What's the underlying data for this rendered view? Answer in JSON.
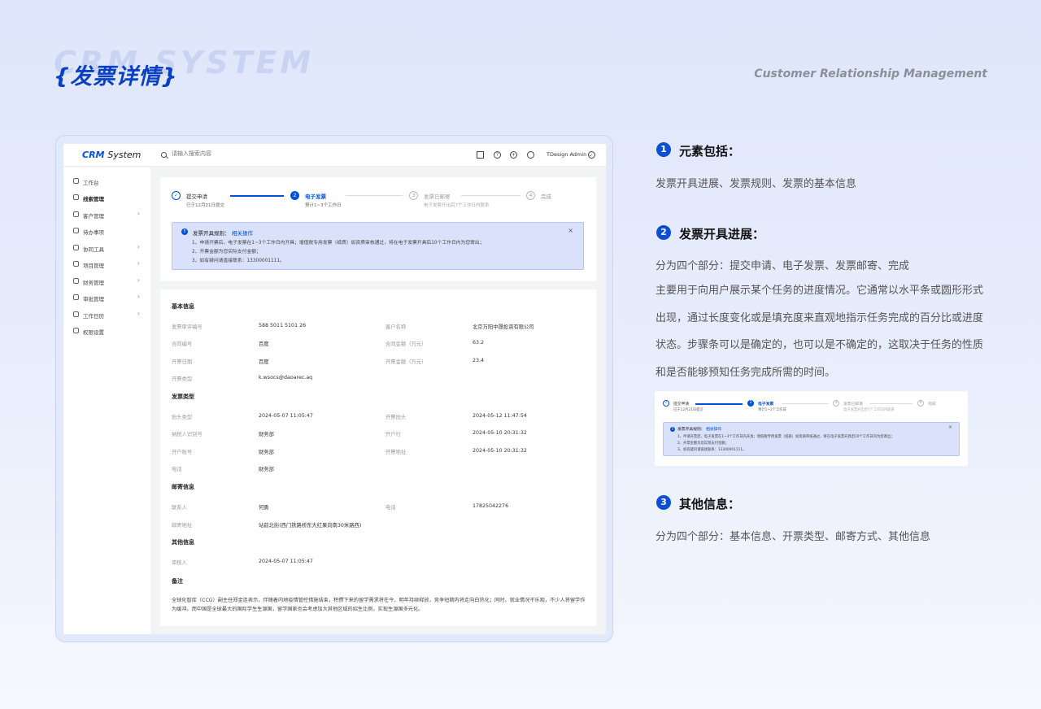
{
  "header": {
    "bg_word": "CRM SYSTEM",
    "title": "{发票详情}",
    "subtitle": "Customer Relationship Management"
  },
  "app": {
    "logo_crm": "CRM",
    "logo_system": "System",
    "search_placeholder": "请输入搜索内容",
    "user_name": "TDesign Admin",
    "sidebar": [
      {
        "label": "工作台",
        "icon": "desktop-icon",
        "chevron": false
      },
      {
        "label": "线索管理",
        "icon": "lead-icon",
        "chevron": false,
        "active": true
      },
      {
        "label": "客户管理",
        "icon": "user-icon",
        "chevron": true
      },
      {
        "label": "待办事项",
        "icon": "todo-icon",
        "chevron": false
      },
      {
        "label": "协同工具",
        "icon": "tool-icon",
        "chevron": true
      },
      {
        "label": "项目管理",
        "icon": "project-icon",
        "chevron": true
      },
      {
        "label": "财务管理",
        "icon": "finance-icon",
        "chevron": true
      },
      {
        "label": "审批管理",
        "icon": "approve-icon",
        "chevron": true
      },
      {
        "label": "工作日历",
        "icon": "calendar-icon",
        "chevron": true
      },
      {
        "label": "权限设置",
        "icon": "shield-icon",
        "chevron": false
      }
    ],
    "steps": [
      {
        "num": "✓",
        "title": "提交申请",
        "sub": "已于12月21日提交",
        "state": "done"
      },
      {
        "num": "2",
        "title": "电子发票",
        "sub": "预计1~3个工作日",
        "state": "cur"
      },
      {
        "num": "3",
        "title": "发票已邮寄",
        "sub": "电子发票开出后7个工作日内联系",
        "state": "todo"
      },
      {
        "num": "4",
        "title": "完成",
        "sub": "",
        "state": "todo"
      }
    ],
    "notice": {
      "icon": "!",
      "title": "发票开具规则：",
      "link": "相关操作",
      "close": "×",
      "lines": [
        "1、申请开票后，电子发票在1~3个工作日内开具；增值税专用发票（纸质）如资质审核通过，将在电子发票开具后10个工作日内为您寄出；",
        "2、开票金额为您实际支付金额；",
        "3、如有疑问请直接联系：13300001111。"
      ]
    },
    "basic_title": "基本信息",
    "basic_rows": [
      [
        "发票审评编号",
        "588 5011 5101 26",
        "客户名称",
        "北京万阳中晟投资有限公司"
      ],
      [
        "合同编号",
        "百度",
        "合同金额（万元）",
        "63.2"
      ],
      [
        "开票日期",
        "百度",
        "开票金额（万元）",
        "23.4"
      ],
      [
        "开票类型",
        "k.wsocs@daoarec.aq",
        "",
        ""
      ]
    ],
    "invoice_title": "发票类型",
    "invoice_rows": [
      [
        "抬头类型",
        "2024-05-07 11:05:47",
        "开票抬头",
        "2024-05-12 11:47:54"
      ],
      [
        "纳税人识别号",
        "财务部",
        "开户行",
        "2024-05-10 20:31:32"
      ],
      [
        "开户账号",
        "财务部",
        "开票地址",
        "2024-05-10 20:31:32"
      ],
      [
        "电话",
        "财务部",
        "",
        ""
      ]
    ],
    "mail_title": "邮寄信息",
    "mail_rows": [
      [
        "联系人",
        "何勇",
        "电话",
        "17825042276"
      ],
      [
        "邮寄地址",
        "站前北街(西门铁路桥东大红果向南30米路西)",
        "",
        ""
      ]
    ],
    "other_title": "其他信息",
    "other_rows": [
      [
        "审核人",
        "2024-05-07 11:05:47",
        "",
        ""
      ]
    ],
    "remark_title": "备注",
    "remark_text": "全球化智库（CCG）副主任郑金连表示，伴随着内地疫情管控措施结束，积攒下来的留学需求将在今、明年持续释放，竞争短期内将走向白热化；同时，就业情况不乐观，不少人将留学作为缓冲。而中国是全球最大的国际学生生源国，留学国家也会考虑加大其他区域的招生比例，实现生源国多元化。"
  },
  "right": {
    "sections": [
      {
        "num": "1",
        "heading": "元素包括：",
        "text": "发票开具进展、发票规则、发票的基本信息"
      },
      {
        "num": "2",
        "heading": "发票开具进展：",
        "text": "分为四个部分：提交申请、电子发票、发票邮寄、完成",
        "para": "主要用于向用户展示某个任务的进度情况。它通常以水平条或圆形形式出现，通过长度变化或是填充度来直观地指示任务完成的百分比或进度状态。步骤条可以是确定的，也可以是不确定的，这取决于任务的性质和是否能够预知任务完成所需的时间。"
      },
      {
        "num": "3",
        "heading": "其他信息：",
        "text": "分为四个部分：基本信息、开票类型、邮寄方式、其他信息"
      }
    ]
  }
}
